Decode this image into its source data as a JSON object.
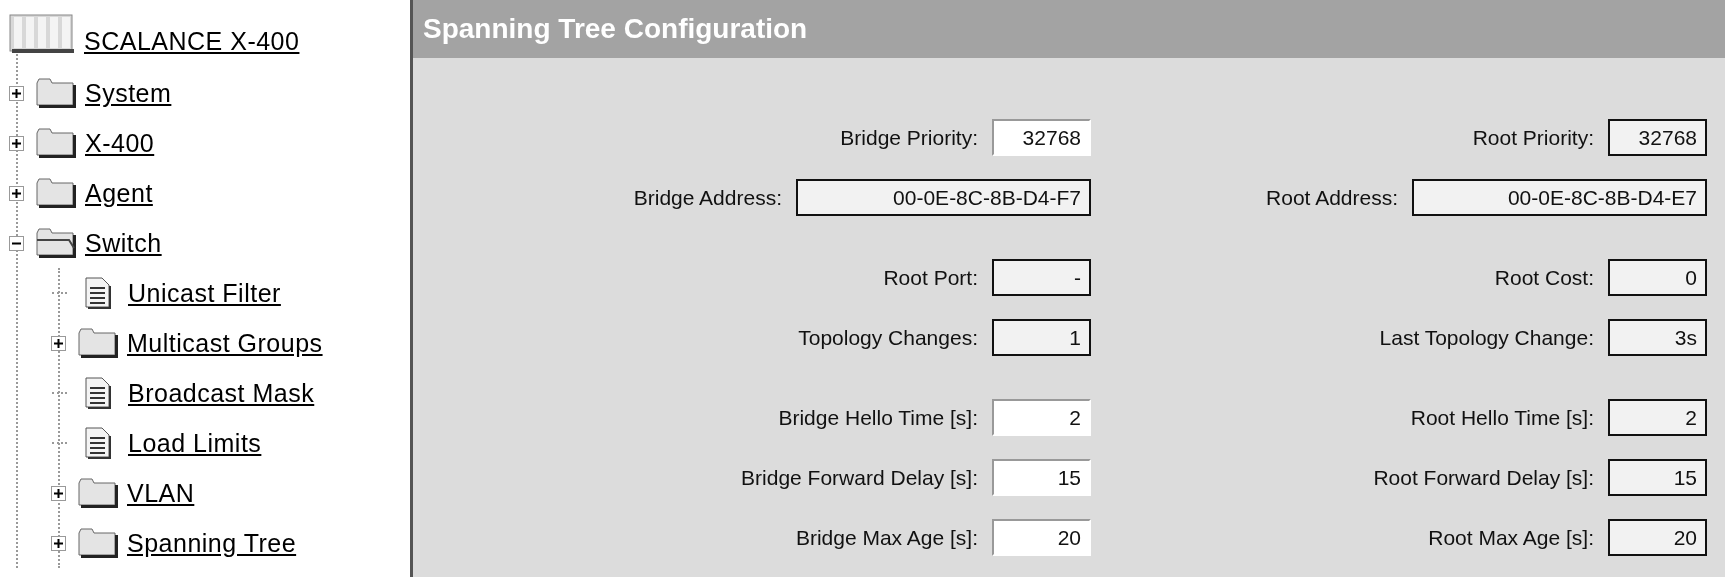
{
  "tree": {
    "label": "SCALANCE X-400",
    "children": [
      {
        "kind": "folder",
        "label": "System",
        "expanded": false
      },
      {
        "kind": "folder",
        "label": "X-400",
        "expanded": false
      },
      {
        "kind": "folder",
        "label": "Agent",
        "expanded": false
      },
      {
        "kind": "folder",
        "label": "Switch",
        "expanded": true,
        "children": [
          {
            "kind": "page",
            "label": "Unicast Filter"
          },
          {
            "kind": "folder",
            "label": "Multicast Groups",
            "expanded": false
          },
          {
            "kind": "page",
            "label": "Broadcast Mask"
          },
          {
            "kind": "page",
            "label": "Load Limits"
          },
          {
            "kind": "folder",
            "label": "VLAN",
            "expanded": false
          },
          {
            "kind": "folder",
            "label": "Spanning Tree",
            "expanded": false
          }
        ]
      }
    ]
  },
  "panel": {
    "title": "Spanning Tree Configuration",
    "columns": [
      {
        "groups": [
          [
            {
              "label": "Bridge Priority:",
              "value": "32768",
              "editable": true,
              "wide": false
            },
            {
              "label": "Bridge Address:",
              "value": "00-0E-8C-8B-D4-F7",
              "editable": false,
              "wide": true
            }
          ],
          [
            {
              "label": "Root Port:",
              "value": "-",
              "editable": false,
              "wide": false
            },
            {
              "label": "Topology Changes:",
              "value": "1",
              "editable": false,
              "wide": false
            }
          ],
          [
            {
              "label": "Bridge Hello Time [s]:",
              "value": "2",
              "editable": true,
              "wide": false
            },
            {
              "label": "Bridge Forward Delay [s]:",
              "value": "15",
              "editable": true,
              "wide": false
            },
            {
              "label": "Bridge Max Age [s]:",
              "value": "20",
              "editable": true,
              "wide": false
            }
          ]
        ]
      },
      {
        "groups": [
          [
            {
              "label": "Root Priority:",
              "value": "32768",
              "editable": false,
              "wide": false
            },
            {
              "label": "Root Address:",
              "value": "00-0E-8C-8B-D4-E7",
              "editable": false,
              "wide": true
            }
          ],
          [
            {
              "label": "Root Cost:",
              "value": "0",
              "editable": false,
              "wide": false
            },
            {
              "label": "Last Topology Change:",
              "value": "3s",
              "editable": false,
              "wide": false
            }
          ],
          [
            {
              "label": "Root Hello Time [s]:",
              "value": "2",
              "editable": false,
              "wide": false
            },
            {
              "label": "Root Forward Delay [s]:",
              "value": "15",
              "editable": false,
              "wide": false
            },
            {
              "label": "Root Max Age [s]:",
              "value": "20",
              "editable": false,
              "wide": false
            }
          ]
        ]
      }
    ]
  }
}
